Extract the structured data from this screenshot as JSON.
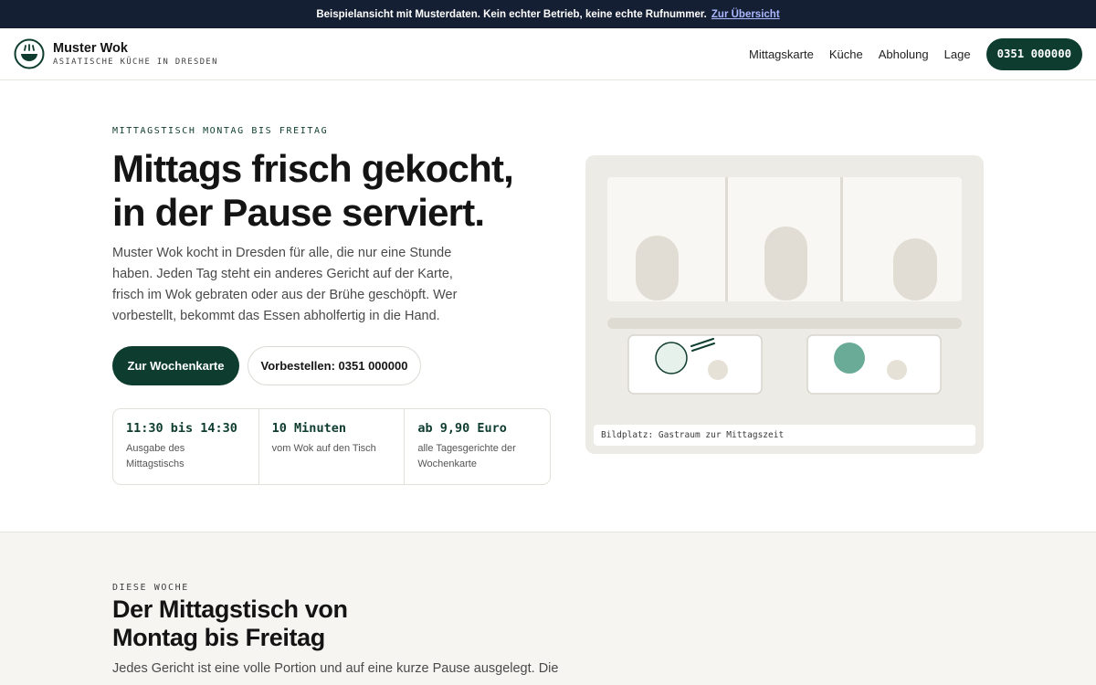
{
  "notice": {
    "text": "Beispielansicht mit Musterdaten. Kein echter Betrieb, keine echte Rufnummer.",
    "link": "Zur Übersicht"
  },
  "brand": {
    "name": "Muster Wok",
    "subtitle": "ASIATISCHE KÜCHE IN DRESDEN"
  },
  "nav": {
    "items": [
      {
        "label": "Mittagskarte"
      },
      {
        "label": "Küche"
      },
      {
        "label": "Abholung"
      },
      {
        "label": "Lage"
      }
    ],
    "phone": "0351 000000"
  },
  "hero": {
    "eyebrow": "MITTAGSTISCH MONTAG BIS FREITAG",
    "title_line1": "Mittags frisch gekocht,",
    "title_line2": "in der Pause serviert.",
    "lead": "Muster Wok kocht in Dresden für alle, die nur eine Stunde haben. Jeden Tag steht ein anderes Gericht auf der Karte, frisch im Wok gebraten oder aus der Brühe geschöpft. Wer vorbestellt, bekommt das Essen abholfertig in die Hand.",
    "primary_button": "Zur Wochenkarte",
    "secondary_button": "Vorbestellen: 0351 000000",
    "facts": [
      {
        "value": "11:30 bis 14:30",
        "label": "Ausgabe des Mittagstischs"
      },
      {
        "value": "10 Minuten",
        "label": "vom Wok auf den Tisch"
      },
      {
        "value": "ab 9,90 Euro",
        "label": "alle Tagesgerichte der Wochenkarte"
      }
    ],
    "image_caption": "Bildplatz: Gastraum zur Mittagszeit"
  },
  "week": {
    "eyebrow": "DIESE WOCHE",
    "title_line1": "Der Mittagstisch von",
    "title_line2": "Montag bis Freitag",
    "text": "Jedes Gericht ist eine volle Portion und auf eine kurze Pause ausgelegt. Die"
  },
  "colors": {
    "accent": "#0e3d30",
    "notice_bg": "#151f33",
    "notice_link": "#a9b8ff",
    "bowl_fill": "#6aab97",
    "section_bg": "#f6f5f1"
  }
}
